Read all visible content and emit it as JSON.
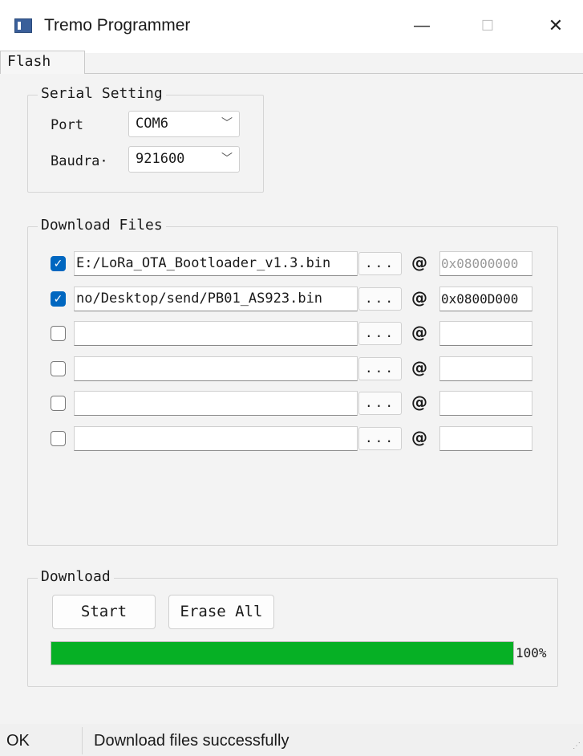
{
  "window": {
    "title": "Tremo Programmer",
    "minimize_glyph": "—",
    "maximize_glyph": "☐",
    "close_glyph": "✕"
  },
  "tabs": [
    {
      "label": "Flash",
      "selected": true
    }
  ],
  "serial_setting": {
    "legend": "Serial Setting",
    "port_label": "Port",
    "port_value": "COM6",
    "baud_label": "Baudra·",
    "baud_value": "921600"
  },
  "download_files": {
    "legend": "Download Files",
    "browse_label": "...",
    "at_symbol": "@",
    "rows": [
      {
        "checked": true,
        "path": "E:/LoRa_OTA_Bootloader_v1.3.bin",
        "address": "0x08000000"
      },
      {
        "checked": true,
        "path": "no/Desktop/send/PB01_AS923.bin",
        "address": "0x0800D000"
      },
      {
        "checked": false,
        "path": "",
        "address": ""
      },
      {
        "checked": false,
        "path": "",
        "address": ""
      },
      {
        "checked": false,
        "path": "",
        "address": ""
      },
      {
        "checked": false,
        "path": "",
        "address": ""
      }
    ]
  },
  "download": {
    "legend": "Download",
    "start_label": "Start",
    "erase_label": "Erase All",
    "progress_percent": 100,
    "progress_text": "100%",
    "progress_color": "#06b025"
  },
  "status": {
    "state": "OK",
    "message": "Download files successfully"
  },
  "icons": {
    "checkmark": "✓",
    "chevron": "﹀"
  }
}
